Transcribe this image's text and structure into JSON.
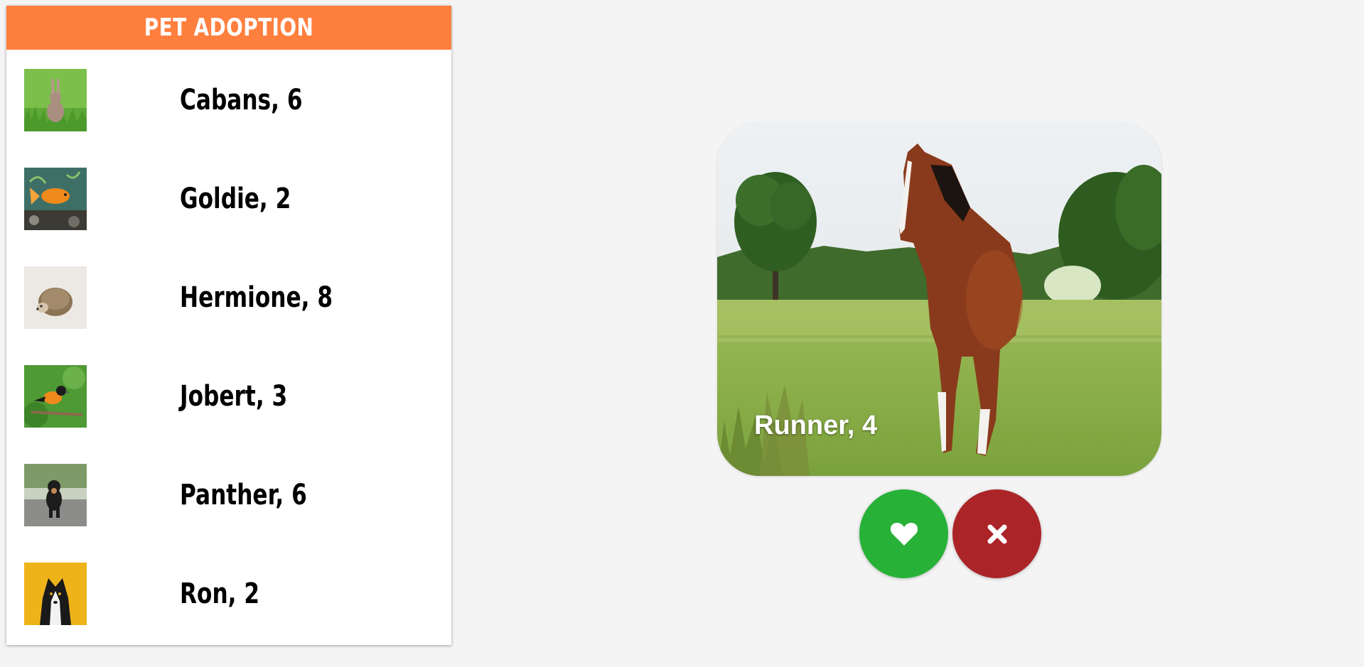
{
  "header": {
    "title": "PET ADOPTION"
  },
  "pets": [
    {
      "label": "Cabans, 6",
      "thumb_icon": "rabbit-photo"
    },
    {
      "label": "Goldie, 2",
      "thumb_icon": "goldfish-photo"
    },
    {
      "label": "Hermione, 8",
      "thumb_icon": "hedgehog-photo"
    },
    {
      "label": "Jobert, 3",
      "thumb_icon": "bird-photo"
    },
    {
      "label": "Panther, 6",
      "thumb_icon": "dog-photo"
    },
    {
      "label": "Ron, 2",
      "thumb_icon": "collie-photo"
    }
  ],
  "card": {
    "name": "Runner, 4",
    "image_icon": "horse-photo"
  },
  "actions": {
    "like_icon": "heart-icon",
    "dislike_icon": "close-icon"
  },
  "colors": {
    "header": "#ff7f3f",
    "like": "#27b237",
    "dislike": "#ab2428",
    "background": "#f4f4f4"
  }
}
